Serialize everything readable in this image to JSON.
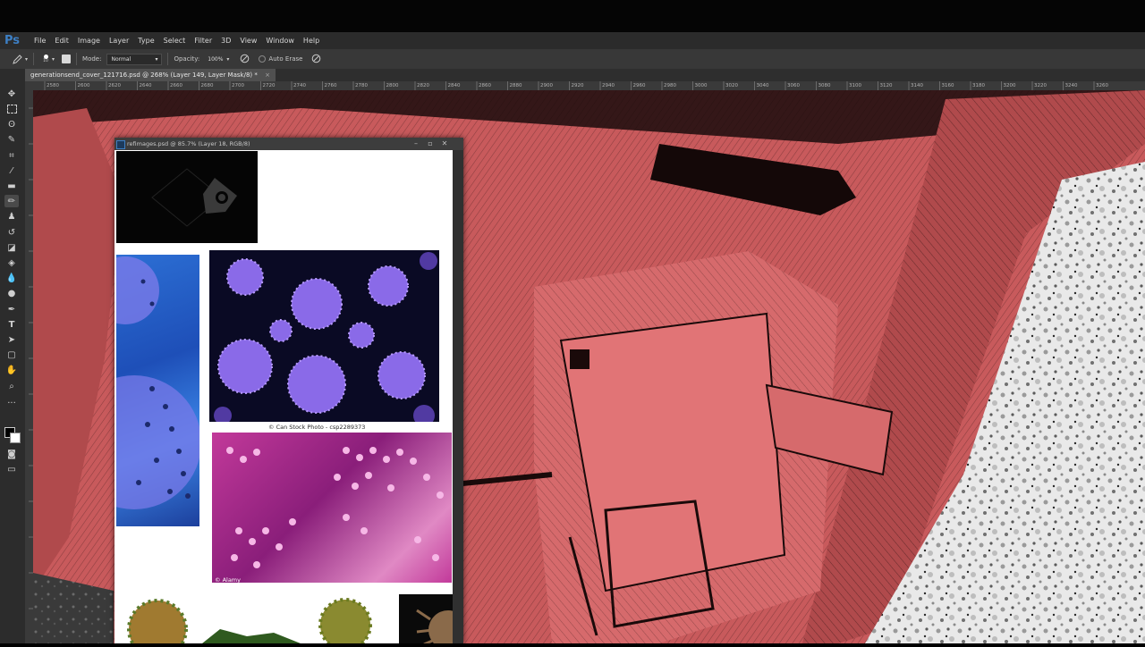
{
  "app": {
    "logo": "Ps"
  },
  "menu": [
    "File",
    "Edit",
    "Image",
    "Layer",
    "Type",
    "Select",
    "Filter",
    "3D",
    "View",
    "Window",
    "Help"
  ],
  "options": {
    "brush_size": "10",
    "mode_label": "Mode:",
    "mode_value": "Normal",
    "opacity_label": "Opacity:",
    "opacity_value": "100%",
    "auto_erase_label": "Auto Erase"
  },
  "document_tab": {
    "title": "generationsend_cover_121716.psd @ 268% (Layer 149, Layer Mask/8) *",
    "close": "×"
  },
  "ruler_ticks": [
    "2580",
    "2600",
    "2620",
    "2640",
    "2660",
    "2680",
    "2700",
    "2720",
    "2740",
    "2760",
    "2780",
    "2800",
    "2820",
    "2840",
    "2860",
    "2880",
    "2900",
    "2920",
    "2940",
    "2960",
    "2980",
    "3000",
    "3020",
    "3040",
    "3060",
    "3080",
    "3100",
    "3120",
    "3140",
    "3160",
    "3180",
    "3200",
    "3220",
    "3240",
    "3260"
  ],
  "floating_window": {
    "title": "refimages.psd @ 85.7% (Layer 18, RGB/8)",
    "credit_canstock": "© Can Stock Photo - csp2289373",
    "credit_alamy": "© Alamy"
  },
  "colors": {
    "accent": "#3d7fc4",
    "canvas_red": "#c85a5c",
    "panel_bg": "#2b2b2b"
  }
}
